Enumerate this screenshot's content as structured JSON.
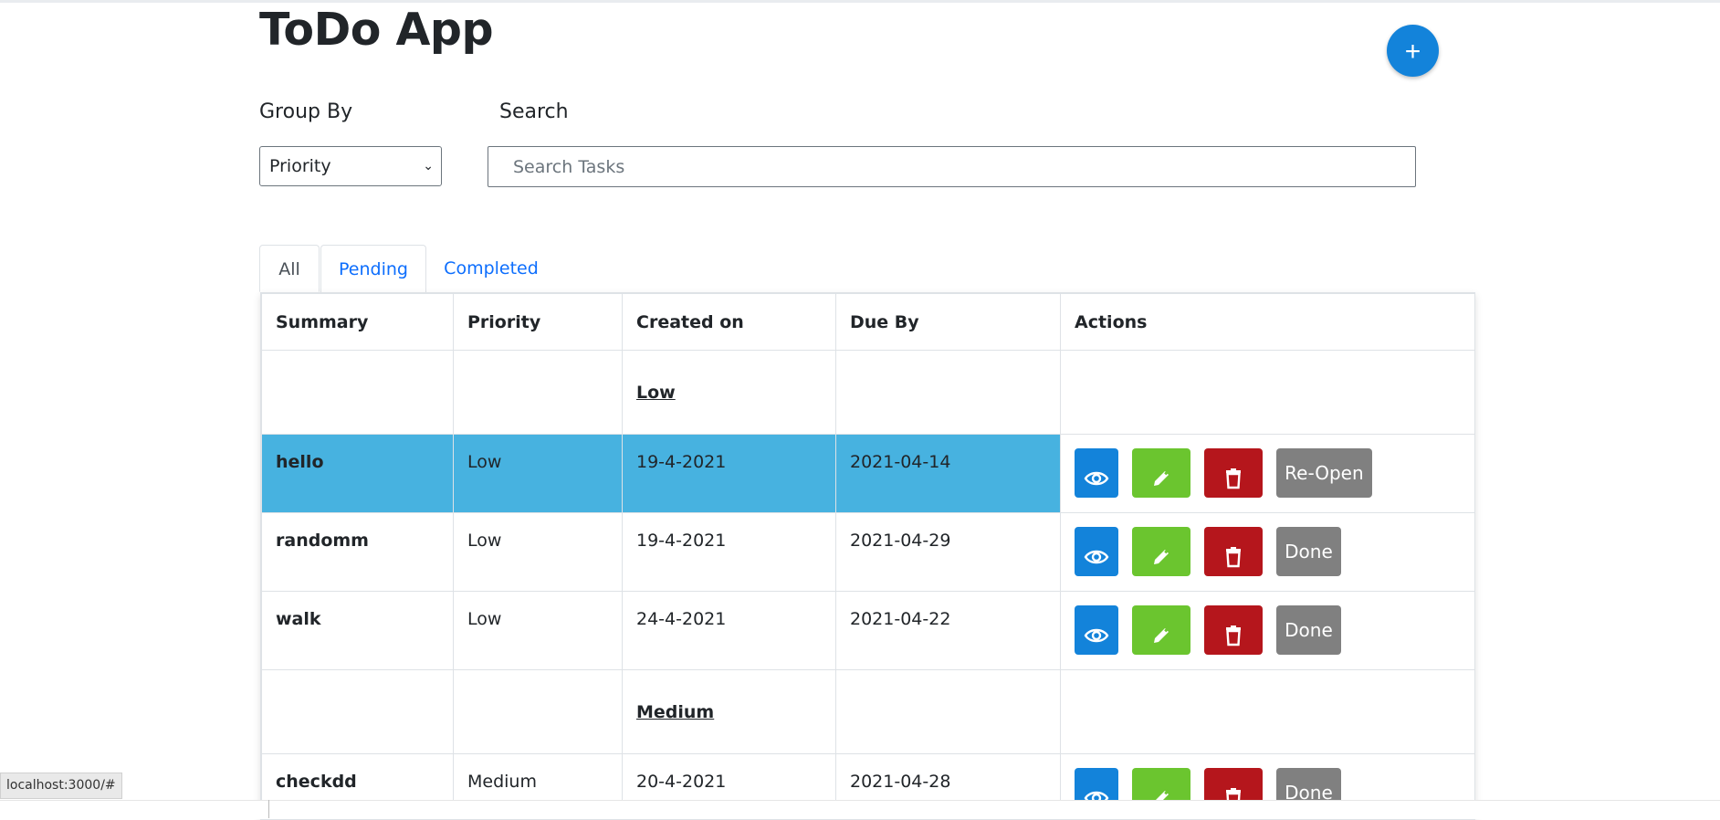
{
  "app": {
    "title": "ToDo App",
    "add_label": "+"
  },
  "controls": {
    "group_by_label": "Group By",
    "group_by_value": "Priority",
    "search_label": "Search",
    "search_placeholder": "Search Tasks"
  },
  "tabs": [
    {
      "label": "All",
      "active": true
    },
    {
      "label": "Pending",
      "active": false
    },
    {
      "label": "Completed",
      "active": false
    }
  ],
  "table": {
    "headers": [
      "Summary",
      "Priority",
      "Created on",
      "Due By",
      "Actions"
    ],
    "groups": [
      {
        "name": "Low",
        "rows": [
          {
            "summary": "hello",
            "priority": "Low",
            "created": "19-4-2021",
            "due": "2021-04-14",
            "state_action": "Re-Open",
            "highlighted": true
          },
          {
            "summary": "randomm",
            "priority": "Low",
            "created": "19-4-2021",
            "due": "2021-04-29",
            "state_action": "Done",
            "highlighted": false
          },
          {
            "summary": "walk",
            "priority": "Low",
            "created": "24-4-2021",
            "due": "2021-04-22",
            "state_action": "Done",
            "highlighted": false
          }
        ]
      },
      {
        "name": "Medium",
        "rows": [
          {
            "summary": "checkdd",
            "priority": "Medium",
            "created": "20-4-2021",
            "due": "2021-04-28",
            "state_action": "Done",
            "highlighted": false
          }
        ]
      }
    ]
  },
  "status_bar": {
    "url": "localhost:3000/#"
  },
  "colors": {
    "primary": "#1383da",
    "view_button": "#1383da",
    "edit_button": "#6bc52f",
    "delete_button": "#b5161c",
    "state_button": "#808080",
    "row_highlight": "#47b2e0"
  },
  "icons": {
    "view": "eye-icon",
    "edit": "pencil-icon",
    "delete": "trash-icon",
    "add": "plus-icon"
  }
}
